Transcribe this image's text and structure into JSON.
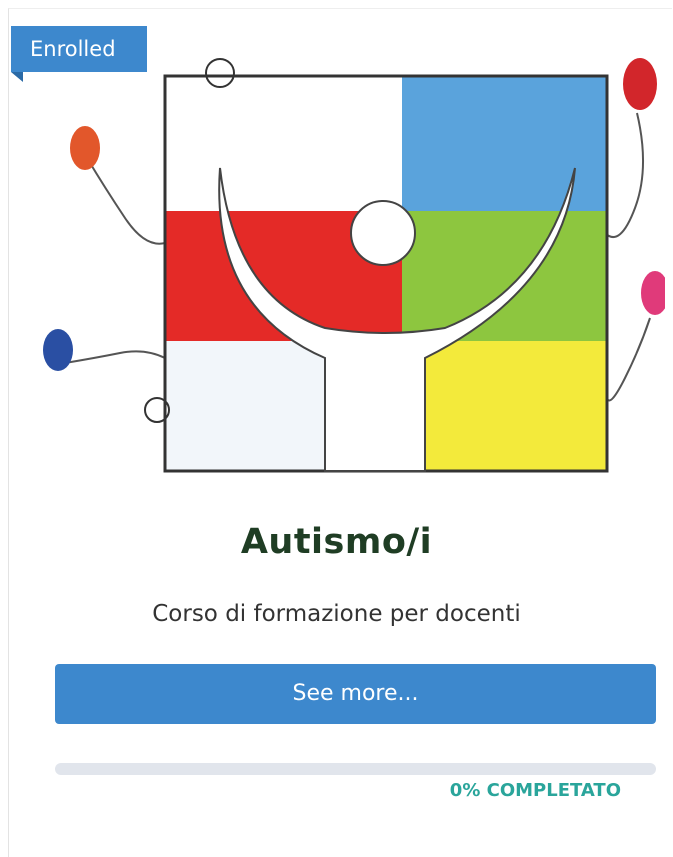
{
  "badge": {
    "label": "Enrolled"
  },
  "course": {
    "title": "Autismo/i",
    "subtitle": "Corso di formazione per docenti",
    "button_label": "See more...",
    "image_icon": "autism-puzzle-illustration"
  },
  "progress": {
    "value": 0,
    "label": "0% COMPLETATO"
  },
  "colors": {
    "accent_blue": "#3d88cd",
    "progress_text": "#2aa59b",
    "title": "#1f3d24"
  }
}
